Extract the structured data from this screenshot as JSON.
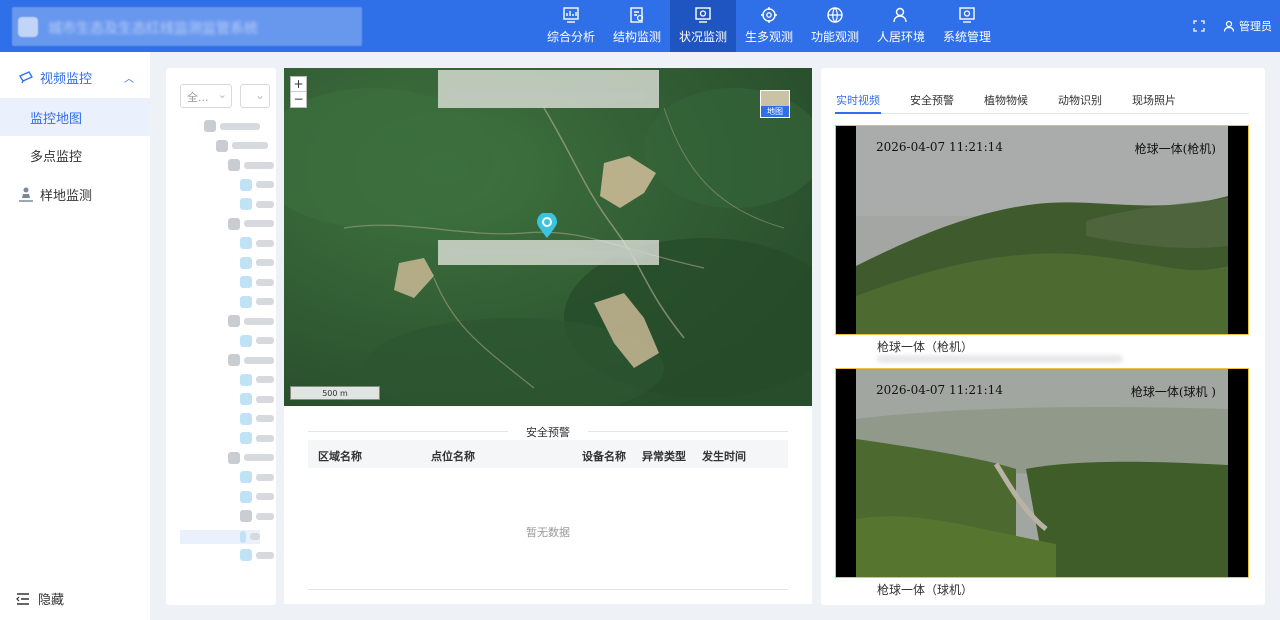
{
  "header": {
    "app_title": "城市生态及生态红线监测监管系统",
    "nav": [
      {
        "label": "综合分析",
        "icon": "chart-monitor-icon"
      },
      {
        "label": "结构监测",
        "icon": "document-icon"
      },
      {
        "label": "状况监测",
        "icon": "monitor-icon"
      },
      {
        "label": "生多观测",
        "icon": "gear-network-icon"
      },
      {
        "label": "功能观测",
        "icon": "globe-icon"
      },
      {
        "label": "人居环境",
        "icon": "person-icon"
      },
      {
        "label": "系统管理",
        "icon": "settings-icon"
      }
    ],
    "user_label": "管理员"
  },
  "sidebar": {
    "group_label": "视频监控",
    "sub_items": [
      "监控地图",
      "多点监控"
    ],
    "other_item": "样地监测",
    "hide_label": "隐藏"
  },
  "tree": {
    "select_value": "全..."
  },
  "map": {
    "scale_label": "500 m",
    "maptype_label": "地图"
  },
  "alerts": {
    "title": "安全预警",
    "columns": [
      "区域名称",
      "点位名称",
      "设备名称",
      "异常类型",
      "发生时间"
    ],
    "empty_text": "暂无数据"
  },
  "right": {
    "tabs": [
      "实时视频",
      "安全预警",
      "植物物候",
      "动物识别",
      "现场照片"
    ],
    "videos": [
      {
        "timestamp": "2026-04-07  11:21:14",
        "camera": "枪球一体(枪机)",
        "caption": "枪球一体（枪机）"
      },
      {
        "timestamp": "2026-04-07 11:21:14",
        "camera": "枪球一体(球机 )",
        "caption": "枪球一体（球机）"
      }
    ]
  }
}
